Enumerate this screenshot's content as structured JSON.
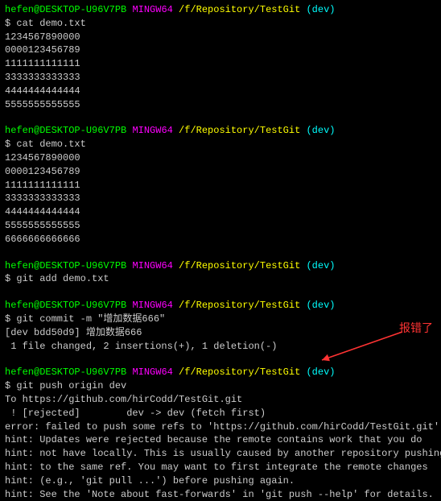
{
  "blocks": [
    {
      "prompt": {
        "user_host": "hefen@DESKTOP-U96V7PB",
        "mingw": "MINGW64",
        "path": "/f/Repository/TestGit",
        "branch": "(dev)"
      },
      "command": "$ cat demo.txt",
      "output": [
        "1234567890000",
        "0000123456789",
        "1111111111111",
        "3333333333333",
        "4444444444444",
        "5555555555555"
      ]
    },
    {
      "prompt": {
        "user_host": "hefen@DESKTOP-U96V7PB",
        "mingw": "MINGW64",
        "path": "/f/Repository/TestGit",
        "branch": "(dev)"
      },
      "command": "$ cat demo.txt",
      "output": [
        "1234567890000",
        "0000123456789",
        "1111111111111",
        "3333333333333",
        "4444444444444",
        "5555555555555",
        "6666666666666"
      ]
    },
    {
      "prompt": {
        "user_host": "hefen@DESKTOP-U96V7PB",
        "mingw": "MINGW64",
        "path": "/f/Repository/TestGit",
        "branch": "(dev)"
      },
      "command": "$ git add demo.txt",
      "output": []
    },
    {
      "prompt": {
        "user_host": "hefen@DESKTOP-U96V7PB",
        "mingw": "MINGW64",
        "path": "/f/Repository/TestGit",
        "branch": "(dev)"
      },
      "command": "$ git commit -m \"增加数据666\"",
      "output": [
        "[dev bdd50d9] 增加数据666",
        " 1 file changed, 2 insertions(+), 1 deletion(-)"
      ]
    },
    {
      "prompt": {
        "user_host": "hefen@DESKTOP-U96V7PB",
        "mingw": "MINGW64",
        "path": "/f/Repository/TestGit",
        "branch": "(dev)"
      },
      "command": "$ git push origin dev",
      "output": [
        "To https://github.com/hirCodd/TestGit.git",
        " ! [rejected]        dev -> dev (fetch first)",
        "error: failed to push some refs to 'https://github.com/hirCodd/TestGit.git'",
        "hint: Updates were rejected because the remote contains work that you do",
        "hint: not have locally. This is usually caused by another repository pushing",
        "hint: to the same ref. You may want to first integrate the remote changes",
        "hint: (e.g., 'git pull ...') before pushing again.",
        "hint: See the 'Note about fast-forwards' in 'git push --help' for details."
      ]
    }
  ],
  "annotation": "报错了"
}
